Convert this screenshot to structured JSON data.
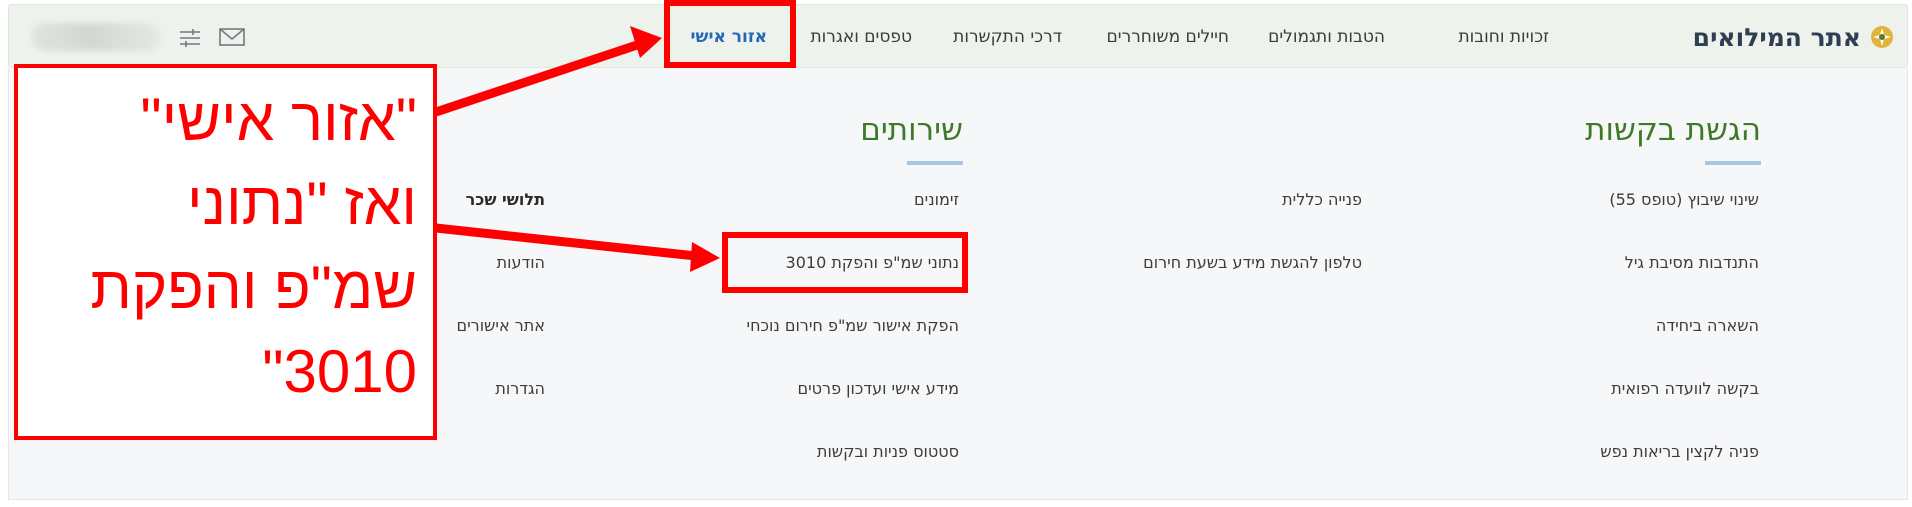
{
  "header": {
    "logo_text": "אתר המילואים",
    "nav": [
      {
        "label": "זכויות וחובות",
        "active": false
      },
      {
        "label": "הטבות ותגמולים",
        "active": false
      },
      {
        "label": "חיילים משוחררים",
        "active": false
      },
      {
        "label": "דרכי התקשרות",
        "active": false
      },
      {
        "label": "טפסים ואגרות",
        "active": false
      },
      {
        "label": "אזור אישי",
        "active": true
      }
    ],
    "icons": [
      "settings-sliders-icon",
      "mail-icon"
    ]
  },
  "menu": {
    "sections": [
      {
        "title": "הגשת בקשות",
        "links": [
          "שינוי שיבוץ (טופס 55)",
          "התנדבות מסיבת גיל",
          "השארה ביחידה",
          "בקשה לוועדה רפואית",
          "פניה לקצין בריאות נפש"
        ]
      },
      {
        "title": "",
        "links": [
          "פנייה כללית",
          "טלפון להגשת מידע בשעת חירום"
        ]
      },
      {
        "title": "שירותים",
        "links": [
          "זימונים",
          "נתוני שמ\"פ והפקת 3010",
          "הפקת אישור שמ\"פ חירום נוכחי",
          "מידע אישי ועדכון פרטים",
          "סטטוס פניות ובקשות"
        ]
      },
      {
        "title": "",
        "links": [
          "תלושי שכר",
          "הודעות",
          "אתר אישורים",
          "הגדרות"
        ]
      }
    ]
  },
  "annotation": {
    "lines": [
      "\"אזור אישי\"",
      "ואז \"נתוני",
      "שמ\"פ והפקת",
      "3010\""
    ],
    "color": "#ff0000"
  },
  "colors": {
    "accent": "#2767b8",
    "section_title": "#3e7a27",
    "annotation": "#ff0000"
  }
}
